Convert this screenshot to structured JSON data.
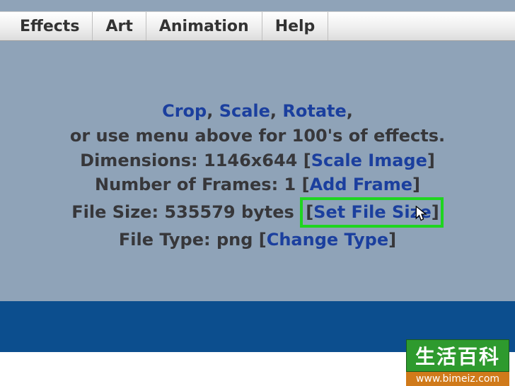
{
  "menu": {
    "items": [
      {
        "label": "Effects"
      },
      {
        "label": "Art"
      },
      {
        "label": "Animation"
      },
      {
        "label": "Help"
      }
    ]
  },
  "line1": {
    "crop": "Crop",
    "sep1": ", ",
    "scale": "Scale",
    "sep2": ", ",
    "rotate": "Rotate",
    "trail": ","
  },
  "line2": "or use menu above for 100's of effects.",
  "line3": {
    "prefix": "Dimensions: 1146x644 [",
    "link": "Scale Image",
    "suffix": "]"
  },
  "line4": {
    "prefix": "Number of Frames: 1 [",
    "link": "Add Frame",
    "suffix": "]"
  },
  "line5": {
    "prefix": "File Size: 535579 bytes ",
    "open": "[",
    "link": "Set File Size",
    "close": "]"
  },
  "line6": {
    "prefix": "File Type: png [",
    "link": "Change Type",
    "suffix": "]"
  },
  "watermark": {
    "top": "生活百科",
    "url": "www.bimeiz.com"
  }
}
